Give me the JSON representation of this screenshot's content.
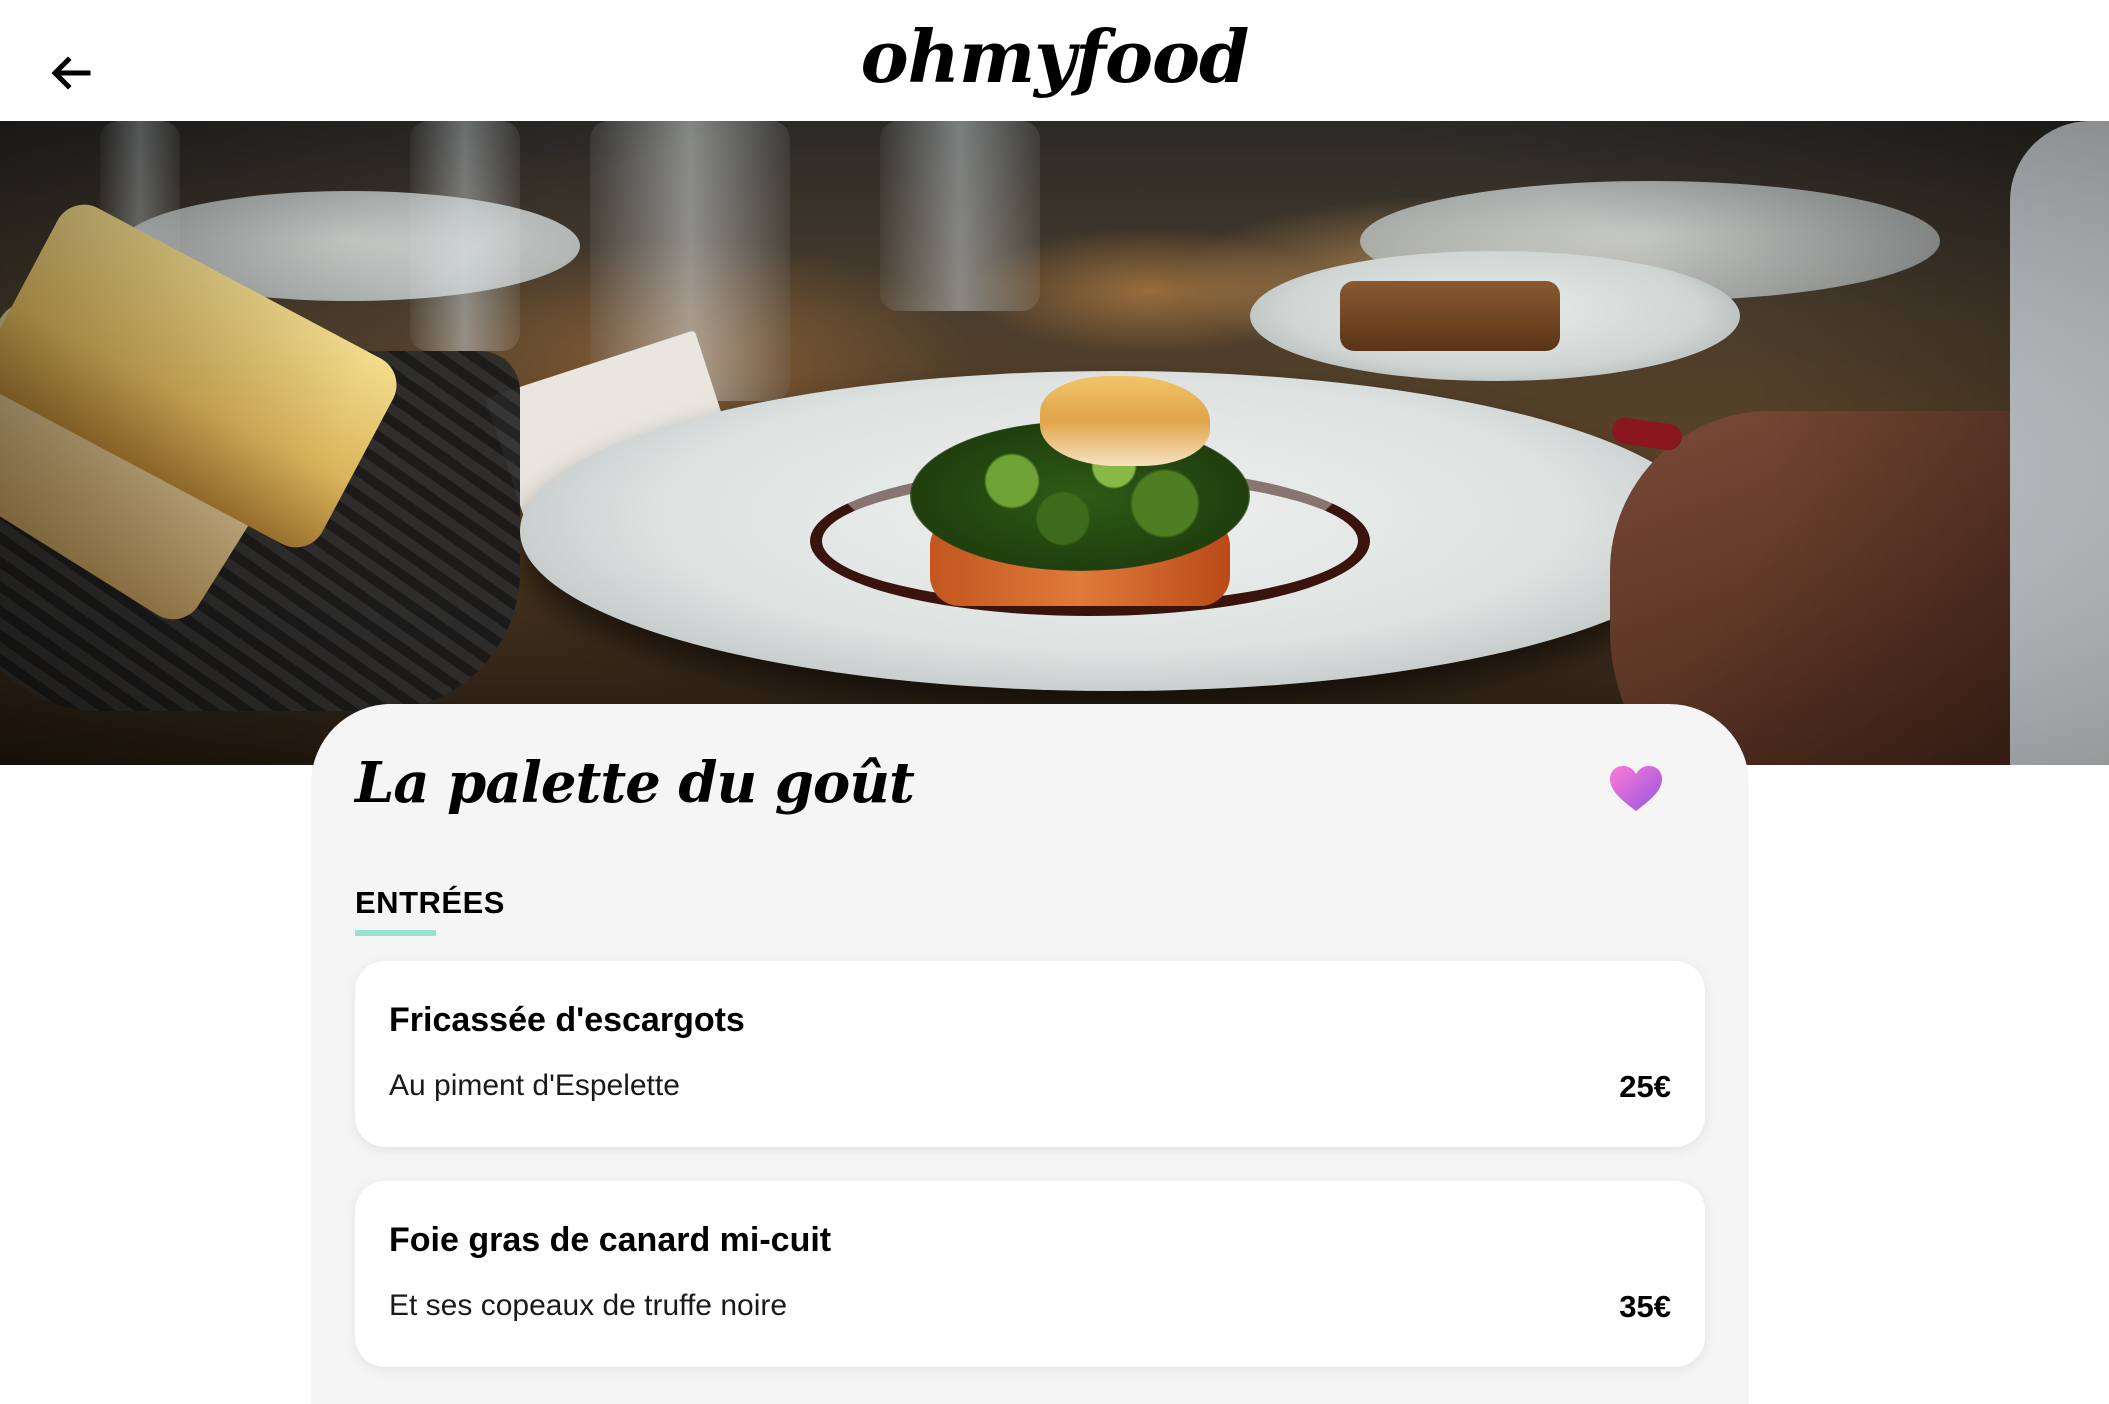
{
  "header": {
    "back_icon": "arrow-left-icon",
    "logo": "ohmyfood"
  },
  "hero": {
    "image": "restaurant-plated-dish-photo"
  },
  "restaurant": {
    "name": "La palette du goût",
    "like_icon": "heart-icon",
    "like_color": "#bc69e8"
  },
  "menu": {
    "section_title": "ENTRÉES",
    "accent_color": "#99e2d0",
    "items": [
      {
        "name": "Fricassée d'escargots",
        "description": "Au piment d'Espelette",
        "price": "25€"
      },
      {
        "name": "Foie gras de canard mi-cuit",
        "description": "Et ses copeaux de truffe noire",
        "price": "35€"
      }
    ]
  }
}
